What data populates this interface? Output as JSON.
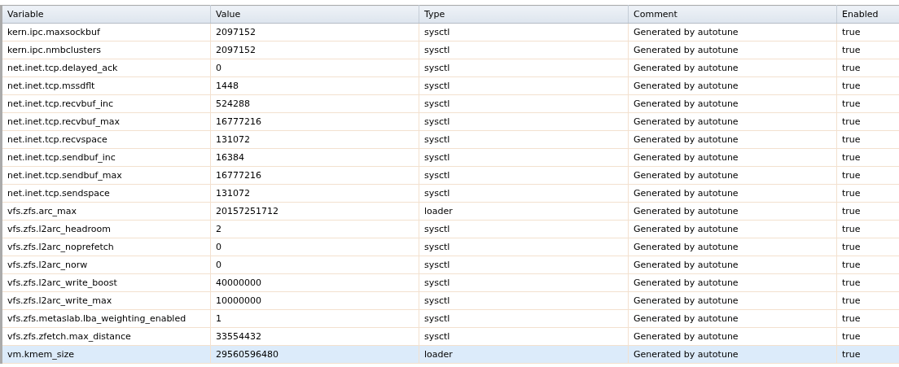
{
  "table": {
    "columns": [
      "Variable",
      "Value",
      "Type",
      "Comment",
      "Enabled"
    ],
    "rows": [
      {
        "cells": [
          "kern.ipc.maxsockbuf",
          "2097152",
          "sysctl",
          "Generated by autotune",
          "true"
        ],
        "selected": false
      },
      {
        "cells": [
          "kern.ipc.nmbclusters",
          "2097152",
          "sysctl",
          "Generated by autotune",
          "true"
        ],
        "selected": false
      },
      {
        "cells": [
          "net.inet.tcp.delayed_ack",
          "0",
          "sysctl",
          "Generated by autotune",
          "true"
        ],
        "selected": false
      },
      {
        "cells": [
          "net.inet.tcp.mssdflt",
          "1448",
          "sysctl",
          "Generated by autotune",
          "true"
        ],
        "selected": false
      },
      {
        "cells": [
          "net.inet.tcp.recvbuf_inc",
          "524288",
          "sysctl",
          "Generated by autotune",
          "true"
        ],
        "selected": false
      },
      {
        "cells": [
          "net.inet.tcp.recvbuf_max",
          "16777216",
          "sysctl",
          "Generated by autotune",
          "true"
        ],
        "selected": false
      },
      {
        "cells": [
          "net.inet.tcp.recvspace",
          "131072",
          "sysctl",
          "Generated by autotune",
          "true"
        ],
        "selected": false
      },
      {
        "cells": [
          "net.inet.tcp.sendbuf_inc",
          "16384",
          "sysctl",
          "Generated by autotune",
          "true"
        ],
        "selected": false
      },
      {
        "cells": [
          "net.inet.tcp.sendbuf_max",
          "16777216",
          "sysctl",
          "Generated by autotune",
          "true"
        ],
        "selected": false
      },
      {
        "cells": [
          "net.inet.tcp.sendspace",
          "131072",
          "sysctl",
          "Generated by autotune",
          "true"
        ],
        "selected": false
      },
      {
        "cells": [
          "vfs.zfs.arc_max",
          "20157251712",
          "loader",
          "Generated by autotune",
          "true"
        ],
        "selected": false
      },
      {
        "cells": [
          "vfs.zfs.l2arc_headroom",
          "2",
          "sysctl",
          "Generated by autotune",
          "true"
        ],
        "selected": false
      },
      {
        "cells": [
          "vfs.zfs.l2arc_noprefetch",
          "0",
          "sysctl",
          "Generated by autotune",
          "true"
        ],
        "selected": false
      },
      {
        "cells": [
          "vfs.zfs.l2arc_norw",
          "0",
          "sysctl",
          "Generated by autotune",
          "true"
        ],
        "selected": false
      },
      {
        "cells": [
          "vfs.zfs.l2arc_write_boost",
          "40000000",
          "sysctl",
          "Generated by autotune",
          "true"
        ],
        "selected": false
      },
      {
        "cells": [
          "vfs.zfs.l2arc_write_max",
          "10000000",
          "sysctl",
          "Generated by autotune",
          "true"
        ],
        "selected": false
      },
      {
        "cells": [
          "vfs.zfs.metaslab.lba_weighting_enabled",
          "1",
          "sysctl",
          "Generated by autotune",
          "true"
        ],
        "selected": false
      },
      {
        "cells": [
          "vfs.zfs.zfetch.max_distance",
          "33554432",
          "sysctl",
          "Generated by autotune",
          "true"
        ],
        "selected": false
      },
      {
        "cells": [
          "vm.kmem_size",
          "29560596480",
          "loader",
          "Generated by autotune",
          "true"
        ],
        "selected": true
      }
    ]
  }
}
